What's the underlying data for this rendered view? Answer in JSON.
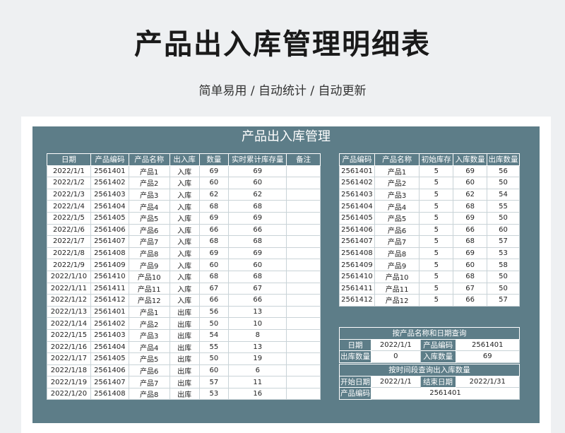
{
  "header": {
    "title": "产品出入库管理明细表",
    "subtitle": "简单易用  /  自动统计  /  自动更新"
  },
  "sheet": {
    "title": "产品出入库管理",
    "left_table": {
      "columns": [
        "日期",
        "产品编码",
        "产品名称",
        "出入库",
        "数量",
        "实时累计库存量",
        "备注"
      ],
      "rows": [
        [
          "2022/1/1",
          "2561401",
          "产品1",
          "入库",
          "69",
          "69",
          ""
        ],
        [
          "2022/1/2",
          "2561402",
          "产品2",
          "入库",
          "60",
          "60",
          ""
        ],
        [
          "2022/1/3",
          "2561403",
          "产品3",
          "入库",
          "62",
          "62",
          ""
        ],
        [
          "2022/1/4",
          "2561404",
          "产品4",
          "入库",
          "68",
          "68",
          ""
        ],
        [
          "2022/1/5",
          "2561405",
          "产品5",
          "入库",
          "69",
          "69",
          ""
        ],
        [
          "2022/1/6",
          "2561406",
          "产品6",
          "入库",
          "66",
          "66",
          ""
        ],
        [
          "2022/1/7",
          "2561407",
          "产品7",
          "入库",
          "68",
          "68",
          ""
        ],
        [
          "2022/1/8",
          "2561408",
          "产品8",
          "入库",
          "69",
          "69",
          ""
        ],
        [
          "2022/1/9",
          "2561409",
          "产品9",
          "入库",
          "60",
          "60",
          ""
        ],
        [
          "2022/1/10",
          "2561410",
          "产品10",
          "入库",
          "68",
          "68",
          ""
        ],
        [
          "2022/1/11",
          "2561411",
          "产品11",
          "入库",
          "67",
          "67",
          ""
        ],
        [
          "2022/1/12",
          "2561412",
          "产品12",
          "入库",
          "66",
          "66",
          ""
        ],
        [
          "2022/1/13",
          "2561401",
          "产品1",
          "出库",
          "56",
          "13",
          ""
        ],
        [
          "2022/1/14",
          "2561402",
          "产品2",
          "出库",
          "50",
          "10",
          ""
        ],
        [
          "2022/1/15",
          "2561403",
          "产品3",
          "出库",
          "54",
          "8",
          ""
        ],
        [
          "2022/1/16",
          "2561404",
          "产品4",
          "出库",
          "55",
          "13",
          ""
        ],
        [
          "2022/1/17",
          "2561405",
          "产品5",
          "出库",
          "50",
          "19",
          ""
        ],
        [
          "2022/1/18",
          "2561406",
          "产品6",
          "出库",
          "60",
          "6",
          ""
        ],
        [
          "2022/1/19",
          "2561407",
          "产品7",
          "出库",
          "57",
          "11",
          ""
        ],
        [
          "2022/1/20",
          "2561408",
          "产品8",
          "出库",
          "53",
          "16",
          ""
        ]
      ]
    },
    "right_table": {
      "columns": [
        "产品编码",
        "产品名称",
        "初始库存",
        "入库数量",
        "出库数量"
      ],
      "rows": [
        [
          "2561401",
          "产品1",
          "5",
          "69",
          "56"
        ],
        [
          "2561402",
          "产品2",
          "5",
          "60",
          "50"
        ],
        [
          "2561403",
          "产品3",
          "5",
          "62",
          "54"
        ],
        [
          "2561404",
          "产品4",
          "5",
          "68",
          "55"
        ],
        [
          "2561405",
          "产品5",
          "5",
          "69",
          "50"
        ],
        [
          "2561406",
          "产品6",
          "5",
          "66",
          "60"
        ],
        [
          "2561407",
          "产品7",
          "5",
          "68",
          "57"
        ],
        [
          "2561408",
          "产品8",
          "5",
          "69",
          "53"
        ],
        [
          "2561409",
          "产品9",
          "5",
          "60",
          "58"
        ],
        [
          "2561410",
          "产品10",
          "5",
          "68",
          "50"
        ],
        [
          "2561411",
          "产品11",
          "5",
          "67",
          "50"
        ],
        [
          "2561412",
          "产品12",
          "5",
          "66",
          "57"
        ]
      ]
    },
    "query1": {
      "title": "按产品名称和日期查询",
      "date_label": "日期",
      "date_value": "2022/1/1",
      "code_label": "产品编码",
      "code_value": "2561401",
      "out_label": "出库数量",
      "out_value": "0",
      "in_label": "入库数量",
      "in_value": "69"
    },
    "query2": {
      "title": "按时间段查询出入库数量",
      "start_label": "开始日期",
      "start_value": "2022/1/1",
      "end_label": "结束日期",
      "end_value": "2022/1/31",
      "code_label": "产品编码",
      "code_value": "2561401"
    }
  }
}
